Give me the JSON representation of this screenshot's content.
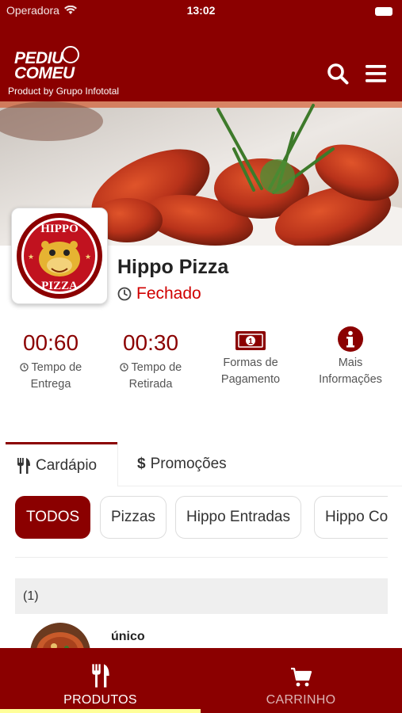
{
  "status_bar": {
    "carrier": "Operadora",
    "time": "13:02"
  },
  "header": {
    "logo_line1": "PEDIU",
    "logo_line2": "COMEU",
    "logo_subtitle": "Product by Grupo Infototal",
    "search_icon": "search-icon",
    "menu_icon": "hamburger-menu-icon"
  },
  "store": {
    "logo_top": "HIPPO",
    "logo_bottom": "PIZZA",
    "name": "Hippo Pizza",
    "status": "Fechado",
    "status_color": "#d00000"
  },
  "stats": [
    {
      "value": "00:60",
      "label_line1": "Tempo de",
      "label_line2": "Entrega"
    },
    {
      "value": "00:30",
      "label_line1": "Tempo de",
      "label_line2": "Retirada"
    },
    {
      "icon": "money-bill-icon",
      "label_line1": "Formas de",
      "label_line2": "Pagamento"
    },
    {
      "icon": "info-icon",
      "label_line1": "Mais",
      "label_line2": "Informações"
    }
  ],
  "tabs": [
    {
      "label": "Cardápio",
      "icon": "utensils-icon",
      "active": true
    },
    {
      "label": "Promoções",
      "icon": "dollar-icon",
      "active": false
    }
  ],
  "categories": [
    {
      "label": "TODOS",
      "active": true
    },
    {
      "label": "Pizzas",
      "active": false
    },
    {
      "label": "Hippo Entradas",
      "active": false
    },
    {
      "label": "Hippo Co",
      "active": false
    }
  ],
  "group": {
    "title": "(1)"
  },
  "products": [
    {
      "name": "único"
    }
  ],
  "bottom_nav": [
    {
      "label": "PRODUTOS",
      "icon": "utensils-icon",
      "active": true
    },
    {
      "label": "CARRINHO",
      "icon": "cart-icon",
      "active": false
    }
  ],
  "colors": {
    "primary": "#8b0000",
    "accent_indicator": "#ffff99"
  }
}
